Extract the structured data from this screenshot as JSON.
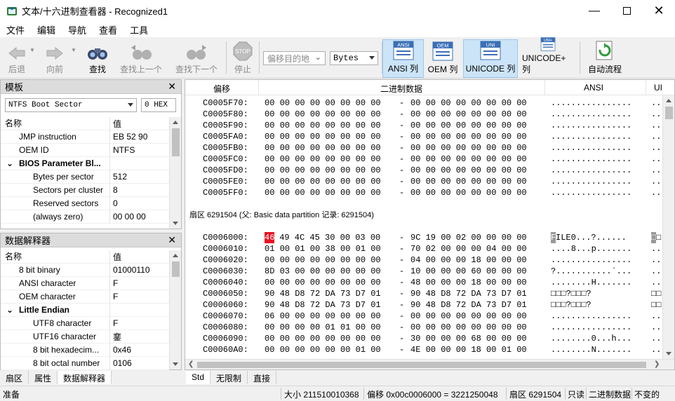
{
  "window": {
    "title": "文本/十六进制查看器 - Recognized1"
  },
  "menu": [
    "文件",
    "编辑",
    "导航",
    "查看",
    "工具"
  ],
  "toolbar": {
    "back": "后退",
    "forward": "向前",
    "find": "查找",
    "find_prev": "查找上一个",
    "find_next": "查找下一个",
    "stop": "停止",
    "offset_placeholder": "偏移目的地",
    "unit": "Bytes",
    "ansi_col": "ANSI 列",
    "oem_col": "OEM 列",
    "unicode_col": "UNICODE 列",
    "unicodeplus_col": "UNICODE+ 列",
    "auto_flow": "自动流程",
    "ansi_icon_text": "ANSI",
    "oem_icon_text": "OEM",
    "uni_icon_text": "UNI",
    "uniplus_icon_text": "UNI+",
    "stop_icon_text": "STOP"
  },
  "template_panel": {
    "title": "模板",
    "template_select": "NTFS Boot Sector",
    "offset_value": "0 HEX",
    "col_name": "名称",
    "col_value": "值",
    "rows": [
      {
        "name": "JMP instruction",
        "value": "EB 52 90",
        "indent": 1,
        "bold": false,
        "expander": ""
      },
      {
        "name": "OEM ID",
        "value": "NTFS",
        "indent": 1,
        "bold": false,
        "expander": ""
      },
      {
        "name": "BIOS Parameter Bl...",
        "value": "",
        "indent": 1,
        "bold": true,
        "expander": "⌄"
      },
      {
        "name": "Bytes per sector",
        "value": "512",
        "indent": 2,
        "bold": false,
        "expander": ""
      },
      {
        "name": "Sectors per cluster",
        "value": "8",
        "indent": 2,
        "bold": false,
        "expander": ""
      },
      {
        "name": "Reserved sectors",
        "value": "0",
        "indent": 2,
        "bold": false,
        "expander": ""
      },
      {
        "name": "(always zero)",
        "value": "00 00 00",
        "indent": 2,
        "bold": false,
        "expander": ""
      }
    ]
  },
  "interpreter_panel": {
    "title": "数据解释器",
    "col_name": "名称",
    "col_value": "值",
    "rows": [
      {
        "name": "8 bit binary",
        "value": "01000110",
        "indent": 1,
        "bold": false,
        "expander": ""
      },
      {
        "name": "ANSI character",
        "value": "F",
        "indent": 1,
        "bold": false,
        "expander": ""
      },
      {
        "name": "OEM character",
        "value": "F",
        "indent": 1,
        "bold": false,
        "expander": ""
      },
      {
        "name": "Little Endian",
        "value": "",
        "indent": 1,
        "bold": true,
        "expander": "⌄"
      },
      {
        "name": "UTF8 character",
        "value": "F",
        "indent": 2,
        "bold": false,
        "expander": ""
      },
      {
        "name": "UTF16 character",
        "value": "䥆",
        "indent": 2,
        "bold": false,
        "expander": ""
      },
      {
        "name": "8 bit hexadecim...",
        "value": "0x46",
        "indent": 2,
        "bold": false,
        "expander": ""
      },
      {
        "name": "8 bit octal number",
        "value": "0106",
        "indent": 2,
        "bold": false,
        "expander": ""
      }
    ]
  },
  "left_tabs": [
    "扇区",
    "属性",
    "数据解释器"
  ],
  "hex": {
    "hdr_offset": "偏移",
    "hdr_binary": "二进制数据",
    "hdr_ansi": "ANSI",
    "hdr_uni": "UI",
    "rows_a": [
      {
        "off": "C0005F70:",
        "b1": "00 00 00 00 00 00 00 00",
        "b2": "00 00 00 00 00 00 00 00",
        "ansi": "................",
        "u": ".."
      },
      {
        "off": "C0005F80:",
        "b1": "00 00 00 00 00 00 00 00",
        "b2": "00 00 00 00 00 00 00 00",
        "ansi": "................",
        "u": ".."
      },
      {
        "off": "C0005F90:",
        "b1": "00 00 00 00 00 00 00 00",
        "b2": "00 00 00 00 00 00 00 00",
        "ansi": "................",
        "u": ".."
      },
      {
        "off": "C0005FA0:",
        "b1": "00 00 00 00 00 00 00 00",
        "b2": "00 00 00 00 00 00 00 00",
        "ansi": "................",
        "u": ".."
      },
      {
        "off": "C0005FB0:",
        "b1": "00 00 00 00 00 00 00 00",
        "b2": "00 00 00 00 00 00 00 00",
        "ansi": "................",
        "u": ".."
      },
      {
        "off": "C0005FC0:",
        "b1": "00 00 00 00 00 00 00 00",
        "b2": "00 00 00 00 00 00 00 00",
        "ansi": "................",
        "u": ".."
      },
      {
        "off": "C0005FD0:",
        "b1": "00 00 00 00 00 00 00 00",
        "b2": "00 00 00 00 00 00 00 00",
        "ansi": "................",
        "u": ".."
      },
      {
        "off": "C0005FE0:",
        "b1": "00 00 00 00 00 00 00 00",
        "b2": "00 00 00 00 00 00 00 00",
        "ansi": "................",
        "u": ".."
      },
      {
        "off": "C0005FF0:",
        "b1": "00 00 00 00 00 00 00 00",
        "b2": "00 00 00 00 00 00 00 00",
        "ansi": "................",
        "u": ".."
      }
    ],
    "sector_label": "扇区 6291504 (父: Basic data partition 记录: 6291504)",
    "first_row": {
      "off": "C0006000:",
      "hl": "46",
      "rest1": " 49 4C 45 30 00 03 00",
      "b2": "9C 19 00 02 00 00 00 00",
      "ansi_sel": "F",
      "ansi_rest": "ILE0...?......",
      "u_sel": "□",
      "u_rest": "□"
    },
    "rows_b": [
      {
        "off": "C0006010:",
        "b1": "01 00 01 00 38 00 01 00",
        "b2": "70 02 00 00 00 04 00 00",
        "ansi": "....8...p.......",
        "u": ".."
      },
      {
        "off": "C0006020:",
        "b1": "00 00 00 00 00 00 00 00",
        "b2": "04 00 00 00 18 00 00 00",
        "ansi": "................",
        "u": ".."
      },
      {
        "off": "C0006030:",
        "b1": "8D 03 00 00 00 00 00 00",
        "b2": "10 00 00 00 60 00 00 00",
        "ansi": "?...........`...",
        "u": ".."
      },
      {
        "off": "C0006040:",
        "b1": "00 00 00 00 00 00 00 00",
        "b2": "48 00 00 00 18 00 00 00",
        "ansi": "........H.......",
        "u": ".."
      },
      {
        "off": "C0006050:",
        "b1": "90 48 D8 72 DA 73 D7 01",
        "b2": "90 48 D8 72 DA 73 D7 01",
        "ansi": "□□□?□□□?",
        "u": "□□"
      },
      {
        "off": "C0006060:",
        "b1": "90 48 D8 72 DA 73 D7 01",
        "b2": "90 48 D8 72 DA 73 D7 01",
        "ansi": "□□□?□□□?",
        "u": "□□"
      },
      {
        "off": "C0006070:",
        "b1": "06 00 00 00 00 00 00 00",
        "b2": "00 00 00 00 00 00 00 00",
        "ansi": "................",
        "u": ".."
      },
      {
        "off": "C0006080:",
        "b1": "00 00 00 00 01 01 00 00",
        "b2": "00 00 00 00 00 00 00 00",
        "ansi": "................",
        "u": ".."
      },
      {
        "off": "C0006090:",
        "b1": "00 00 00 00 00 00 00 00",
        "b2": "30 00 00 00 68 00 00 00",
        "ansi": "........0...h...",
        "u": ".."
      },
      {
        "off": "C00060A0:",
        "b1": "00 00 00 00 00 00 01 00",
        "b2": "4E 00 00 00 18 00 01 00",
        "ansi": "........N.......",
        "u": ".."
      }
    ],
    "dash": "-"
  },
  "hex_tabs": [
    "Std",
    "无限制",
    "直接"
  ],
  "status": {
    "ready": "准备",
    "size": "大小 211510010368",
    "offset": "偏移 0x00c0006000 = 3221250048",
    "sector": "扇区 6291504",
    "readonly": "只读",
    "binary": "二进制数据",
    "immutable": "不变的"
  },
  "colors": {
    "highlight": "#e81123",
    "selected_btn": "#cce4f7"
  }
}
